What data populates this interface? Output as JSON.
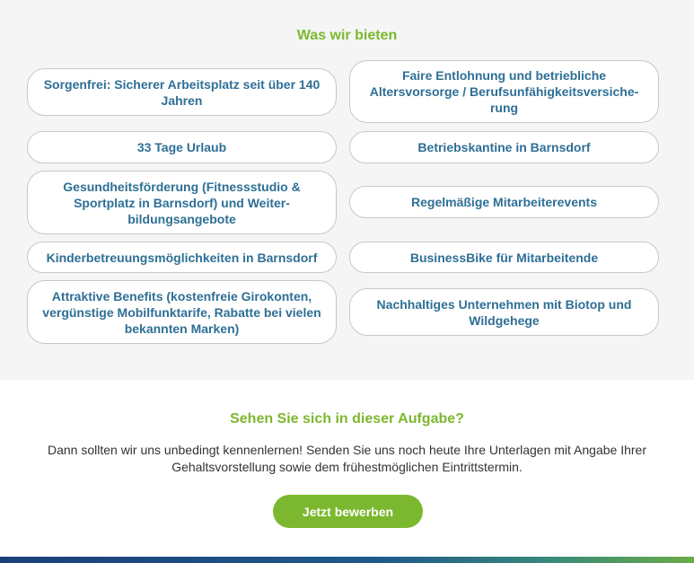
{
  "offers": {
    "title": "Was wir bieten",
    "items": [
      "Sorgenfrei: Sicherer Arbeitsplatz seit über 140 Jahren",
      "Faire Entlohnung und betriebliche Altersvorsorge / Berufsunfähigkeitsversiche-rung",
      "33 Tage Urlaub",
      "Betriebskantine in Barnsdorf",
      "Gesundheitsförderung (Fitnessstudio & Sportplatz in Barnsdorf) und Weiter-bildungsangebote",
      "Regelmäßige Mitarbeiterevents",
      "Kinderbetreuungsmöglichkeiten in Barnsdorf",
      "BusinessBike für Mitarbeitende",
      "Attraktive Benefits (kostenfreie Girokonten, vergünstige Mobilfunktarife, Rabatte bei vielen bekannten Marken)",
      "Nachhaltiges Unternehmen mit Biotop und Wildgehege"
    ]
  },
  "apply": {
    "title": "Sehen Sie sich in dieser Aufgabe?",
    "text": "Dann sollten wir uns unbedingt kennenlernen! Senden Sie uns noch heute Ihre Unterlagen mit Angabe Ihrer Gehaltsvorstellung sowie dem frühestmöglichen Eintrittstermin.",
    "button_label": "Jetzt bewerben"
  },
  "colors": {
    "accent": "#7cb82f",
    "benefit_text": "#2e6f95"
  }
}
